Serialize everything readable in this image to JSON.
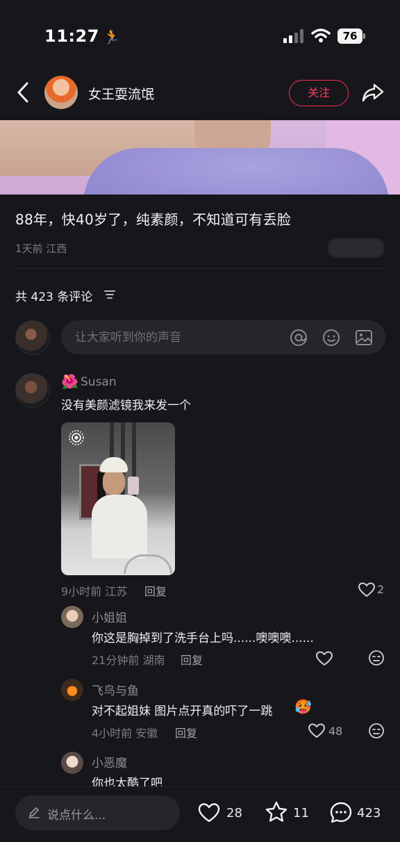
{
  "status_bar": {
    "time": "11:27",
    "battery": "76"
  },
  "header": {
    "author_name": "女王耍流氓",
    "follow_label": "关注"
  },
  "post": {
    "caption": "88年，快40岁了，纯素颜，不知道可有丢脸",
    "meta": "1天前 江西"
  },
  "comments_section": {
    "count_label": "共 423 条评论",
    "input_placeholder": "让大家听到你的声音"
  },
  "comments": [
    {
      "flower_emoji": "🌺",
      "user": "Susan",
      "text": "没有美颜滤镜我来发一个",
      "meta": "9小时前 江苏",
      "reply_label": "回复",
      "likes": "2",
      "replies": [
        {
          "user": "小姐姐",
          "text": "你这是胸掉到了洗手台上吗......噢噢噢......",
          "meta": "21分钟前 湖南",
          "reply_label": "回复"
        },
        {
          "user": "飞鸟与鱼",
          "text": "对不起姐妹 图片点开真的吓了一跳",
          "emoji": "🥵",
          "meta": "4小时前 安徽",
          "reply_label": "回复",
          "likes": "48"
        },
        {
          "user": "小恶魔",
          "text": "你也太酷了吧"
        }
      ]
    }
  ],
  "bottom_bar": {
    "input_placeholder": "说点什么...",
    "likes": "28",
    "favorites": "11",
    "comments": "423"
  },
  "colors": {
    "accent": "#ff2e55",
    "background": "#16161b"
  }
}
